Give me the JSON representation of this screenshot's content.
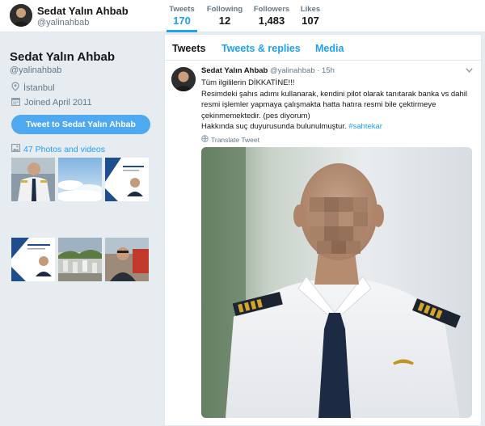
{
  "profile": {
    "name": "Sedat Yalın Ahbab",
    "handle": "@yalinahbab",
    "location": "İstanbul",
    "joined": "Joined April 2011",
    "tweet_to_label": "Tweet to Sedat Yalın Ahbab",
    "photos_label": "47 Photos and videos"
  },
  "stats": [
    {
      "label": "Tweets",
      "value": "170"
    },
    {
      "label": "Following",
      "value": "12"
    },
    {
      "label": "Followers",
      "value": "1,483"
    },
    {
      "label": "Likes",
      "value": "107"
    }
  ],
  "tabs": [
    "Tweets",
    "Tweets & replies",
    "Media"
  ],
  "tweet": {
    "name": "Sedat Yalın Ahbab",
    "handle": "@yalinahbab",
    "time": "· 15h",
    "lines": [
      "Tüm ilgililerin DİKKATİNE!!!",
      "Resimdeki şahıs adımı kullanarak, kendini pilot olarak tanıtarak banka vs dahil",
      "resmi işlemler yapmaya çalışmakta hatta hatıra resmi bile çektirmeye",
      "çekinmemektedir. (pes diyorum)",
      "Hakkında suç duyurusunda bulunulmuştur."
    ],
    "hashtag": "#sahtekar",
    "translate": "Translate Tweet"
  },
  "colors": {
    "accent": "#1da1f2",
    "button": "#4fa9f0",
    "background": "#e6ecf0"
  },
  "icons": {
    "location": "location-pin-icon",
    "joined": "calendar-icon",
    "photos": "photo-icon",
    "translate": "globe-icon",
    "caret": "chevron-down-icon"
  }
}
